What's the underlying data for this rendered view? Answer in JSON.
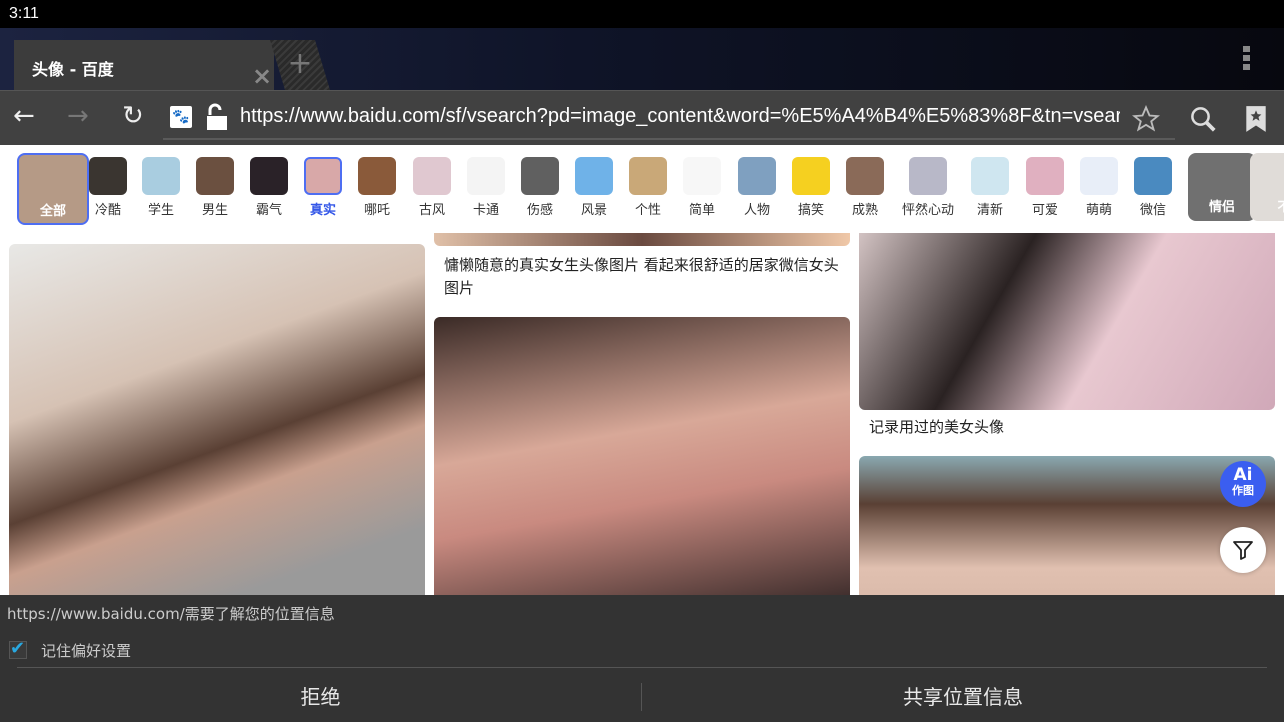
{
  "status_bar": {
    "time": "3:11"
  },
  "browser": {
    "tab": {
      "title": "头像 - 百度",
      "close": "×",
      "new_tab": "+"
    },
    "url": "https://www.baidu.com/sf/vsearch?pd=image_content&word=%E5%A4%B4%E5%83%8F&tn=vsearch",
    "icons": [
      "back-icon",
      "forward-icon",
      "reload-icon",
      "baidu-favicon",
      "lock-icon",
      "star-icon",
      "search-icon",
      "bookmarks-icon",
      "overflow-menu-icon"
    ]
  },
  "categories": [
    {
      "label": "全部",
      "selected": false,
      "color": "#b59a86"
    },
    {
      "label": "冷酷",
      "color": "#3a3530"
    },
    {
      "label": "学生",
      "color": "#a9cde0"
    },
    {
      "label": "男生",
      "color": "#6b5040"
    },
    {
      "label": "霸气",
      "color": "#2a2228"
    },
    {
      "label": "真实",
      "selected": true,
      "color": "#d8a8a8"
    },
    {
      "label": "哪吒",
      "color": "#8a5a3a"
    },
    {
      "label": "古风",
      "color": "#e0c8d0"
    },
    {
      "label": "卡通",
      "color": "#f4f4f4"
    },
    {
      "label": "伤感",
      "color": "#606060"
    },
    {
      "label": "风景",
      "color": "#6fb2e8"
    },
    {
      "label": "个性",
      "color": "#c9a878"
    },
    {
      "label": "简单",
      "color": "#f7f7f7"
    },
    {
      "label": "人物",
      "color": "#7fa0c0"
    },
    {
      "label": "搞笑",
      "color": "#f5d020"
    },
    {
      "label": "成熟",
      "color": "#8a6a58"
    },
    {
      "label": "怦然心动",
      "color": "#b8b8c8"
    },
    {
      "label": "清新",
      "color": "#cfe6f0"
    },
    {
      "label": "可爱",
      "color": "#e0b0c0"
    },
    {
      "label": "萌萌",
      "color": "#e8eef8"
    },
    {
      "label": "微信",
      "color": "#4a8ac0"
    },
    {
      "label": "情侣",
      "color": "#707070"
    },
    {
      "label": "不",
      "color": "#e0dcd8"
    }
  ],
  "results": {
    "captions": [
      "慵懒随意的真实女生头像图片 看起来很舒适的居家微信女头图片",
      "记录用过的美女头像"
    ],
    "ai_button": {
      "top": "Ai",
      "bottom": "作图",
      "color": "#3b5ef0"
    },
    "filter_icon": "filter-icon"
  },
  "permission": {
    "message": "https://www.baidu.com/需要了解您的位置信息",
    "remember": {
      "label": "记住偏好设置",
      "checked": true
    },
    "deny": "拒绝",
    "allow": "共享位置信息"
  }
}
